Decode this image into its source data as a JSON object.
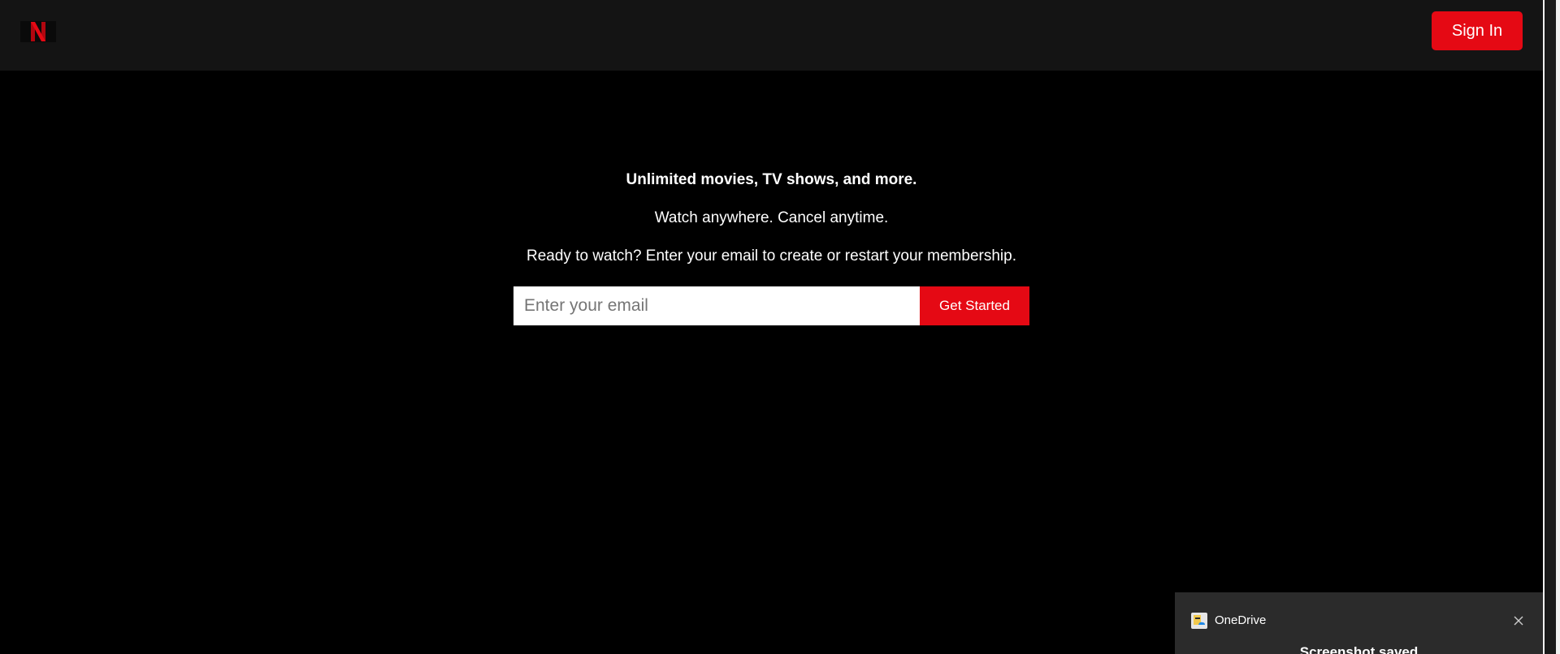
{
  "header": {
    "logo_icon": "netflix-n-icon",
    "sign_in_label": "Sign In"
  },
  "hero": {
    "headline": "Unlimited movies, TV shows, and more.",
    "subline": "Watch anywhere. Cancel anytime.",
    "prompt": "Ready to watch? Enter your email to create or restart your membership.",
    "email_placeholder": "Enter your email",
    "email_value": "",
    "cta_label": "Get Started"
  },
  "toast": {
    "app_icon": "onedrive-icon",
    "app_name": "OneDrive",
    "title": "Screenshot saved",
    "close_icon": "close-icon"
  },
  "colors": {
    "brand_red": "#e50914",
    "header_bg": "#141414",
    "page_bg": "#000000",
    "toast_bg": "#2b2b2b"
  }
}
